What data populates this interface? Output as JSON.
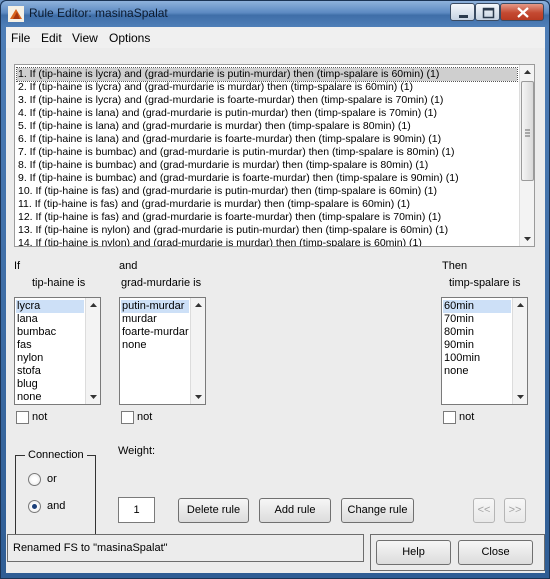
{
  "window": {
    "title": "Rule Editor: masinaSpalat"
  },
  "menu": [
    "File",
    "Edit",
    "View",
    "Options"
  ],
  "rules": [
    "1. If (tip-haine is lycra) and (grad-murdarie is putin-murdar) then (timp-spalare is 60min) (1)",
    "2. If (tip-haine is lycra) and (grad-murdarie is murdar) then (timp-spalare is 60min) (1)",
    "3. If (tip-haine is lycra) and (grad-murdarie is foarte-murdar) then (timp-spalare is 70min) (1)",
    "4. If (tip-haine is lana) and (grad-murdarie is putin-murdar) then (timp-spalare is 70min) (1)",
    "5. If (tip-haine is lana) and (grad-murdarie is murdar) then (timp-spalare is 80min) (1)",
    "6. If (tip-haine is lana) and (grad-murdarie is foarte-murdar) then (timp-spalare is 90min) (1)",
    "7. If (tip-haine is bumbac) and (grad-murdarie is putin-murdar) then (timp-spalare is 80min) (1)",
    "8. If (tip-haine is bumbac) and (grad-murdarie is murdar) then (timp-spalare is 80min) (1)",
    "9. If (tip-haine is bumbac) and (grad-murdarie is foarte-murdar) then (timp-spalare is 90min) (1)",
    "10. If (tip-haine is fas) and (grad-murdarie is putin-murdar) then (timp-spalare is 60min) (1)",
    "11. If (tip-haine is fas) and (grad-murdarie is murdar) then (timp-spalare is 60min) (1)",
    "12. If (tip-haine is fas) and (grad-murdarie is foarte-murdar) then (timp-spalare is 70min) (1)",
    "13. If (tip-haine is nylon) and (grad-murdarie is putin-murdar) then (timp-spalare is 60min) (1)",
    "14. If (tip-haine is nylon) and (grad-murdarie is murdar) then (timp-spalare is 60min) (1)"
  ],
  "labels": {
    "if": "If",
    "and": "and",
    "then": "Then",
    "var1": "tip-haine is",
    "var2": "grad-murdarie is",
    "var3": "timp-spalare is",
    "not": "not",
    "connection": "Connection",
    "or": "or",
    "and_opt": "and",
    "weight": "Weight:"
  },
  "list1": [
    "lycra",
    "lana",
    "bumbac",
    "fas",
    "nylon",
    "stofa",
    "blug",
    "none"
  ],
  "list2": [
    "putin-murdar",
    "murdar",
    "foarte-murdar",
    "none"
  ],
  "list3": [
    "60min",
    "70min",
    "80min",
    "90min",
    "100min",
    "none"
  ],
  "weight_value": "1",
  "buttons": {
    "delete": "Delete rule",
    "add": "Add rule",
    "change": "Change rule",
    "prev": "<<",
    "next": ">>",
    "help": "Help",
    "close": "Close"
  },
  "status": "Renamed FS to \"masinaSpalat\"",
  "selected": {
    "rule": 0,
    "list1": 0,
    "list2": 0,
    "list3": 0,
    "connection": "and"
  }
}
